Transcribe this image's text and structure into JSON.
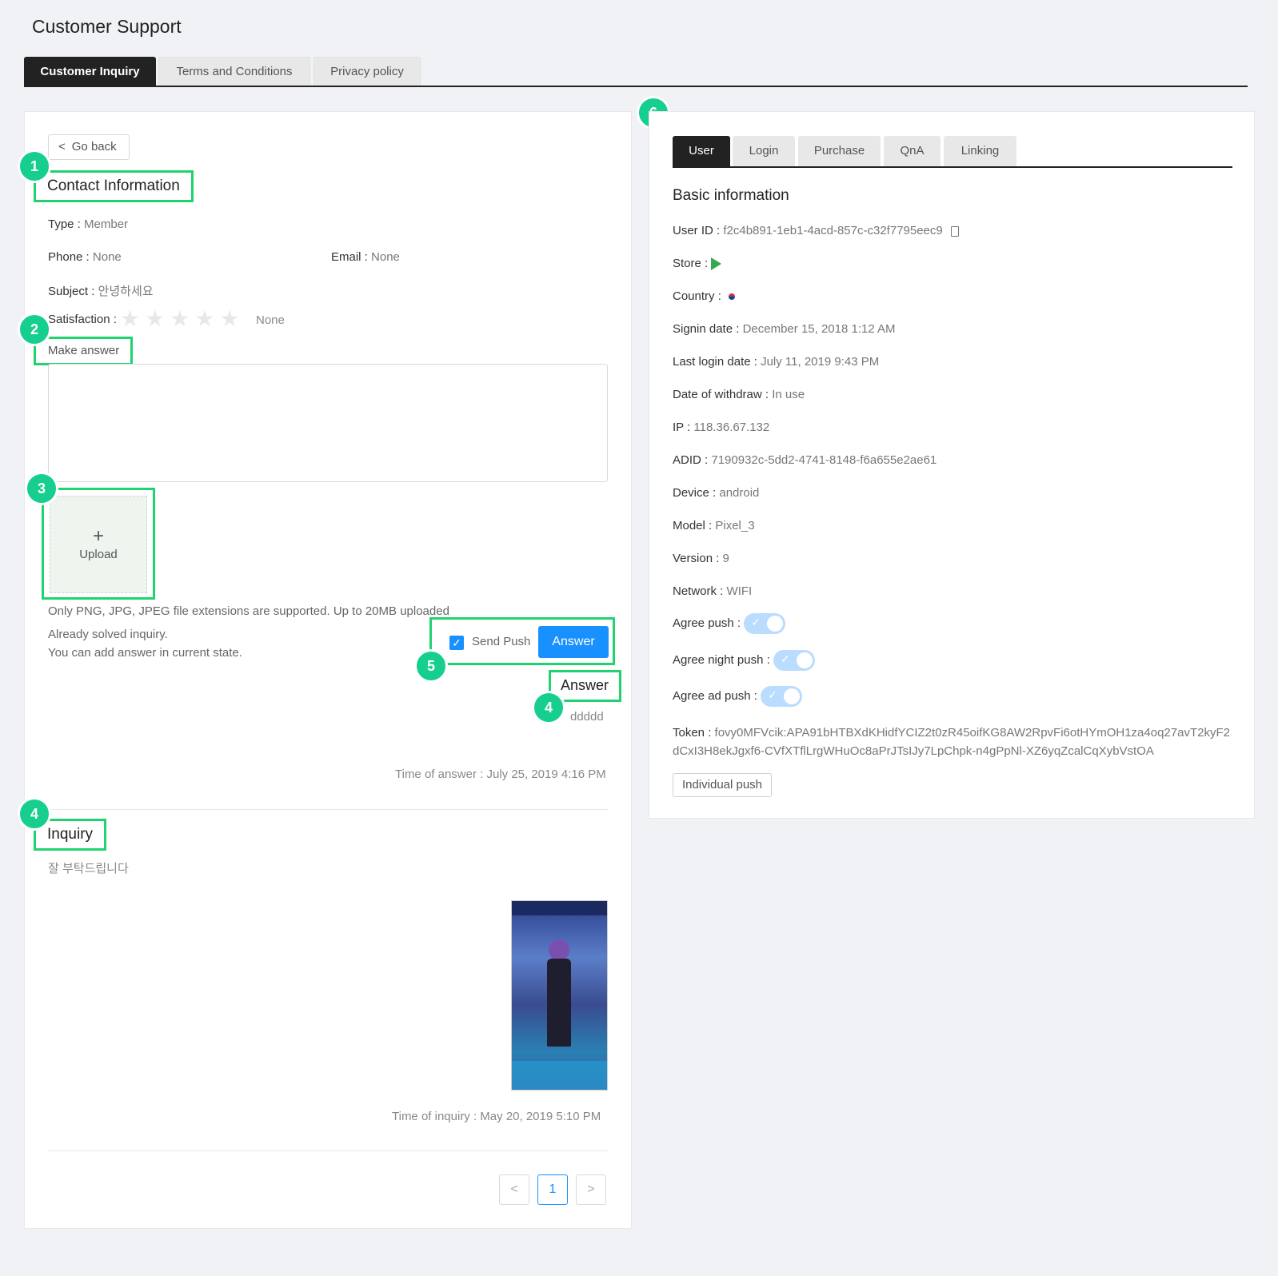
{
  "header": {
    "title": "Customer Support"
  },
  "main_tabs": [
    {
      "label": "Customer Inquiry"
    },
    {
      "label": "Terms and Conditions"
    },
    {
      "label": "Privacy policy"
    }
  ],
  "left": {
    "go_back": "Go back",
    "contact_title": "Contact Information",
    "type_label": "Type :",
    "type_value": "Member",
    "phone_label": "Phone :",
    "phone_value": "None",
    "email_label": "Email :",
    "email_value": "None",
    "subject_label": "Subject :",
    "subject_value": "안녕하세요",
    "satisfaction_label": "Satisfaction :",
    "satisfaction_value": "None",
    "satisfaction_stars": 0,
    "make_answer": "Make answer",
    "upload_label": "Upload",
    "upload_note": "Only PNG, JPG, JPEG file extensions are supported. Up to 20MB uploaded",
    "solved_line1": "Already solved inquiry.",
    "solved_line2": "You can add answer in current state.",
    "send_push_label": "Send Push",
    "send_push_checked": true,
    "answer_button": "Answer",
    "answer_title": "Answer",
    "answer_text": "ddddd",
    "answer_time": "Time of answer : July 25, 2019 4:16 PM",
    "inquiry_title": "Inquiry",
    "inquiry_text": "잘 부탁드립니다",
    "inquiry_time": "Time of inquiry : May 20, 2019 5:10 PM",
    "pagination": {
      "prev": "<",
      "current": "1",
      "next": ">"
    }
  },
  "badges": {
    "b1": "1",
    "b2": "2",
    "b3": "3",
    "b4a": "4",
    "b4b": "4",
    "b5": "5",
    "b6": "6"
  },
  "right": {
    "tabs": [
      {
        "label": "User"
      },
      {
        "label": "Login"
      },
      {
        "label": "Purchase"
      },
      {
        "label": "QnA"
      },
      {
        "label": "Linking"
      }
    ],
    "section_title": "Basic information",
    "user_id_label": "User ID :",
    "user_id_value": "f2c4b891-1eb1-4acd-857c-c32f7795eec9",
    "store_label": "Store :",
    "country_label": "Country :",
    "signin_label": "Signin date :",
    "signin_value": "December 15, 2018 1:12 AM",
    "lastlogin_label": "Last login date :",
    "lastlogin_value": "July 11, 2019 9:43 PM",
    "withdraw_label": "Date of withdraw :",
    "withdraw_value": "In use",
    "ip_label": "IP :",
    "ip_value": "118.36.67.132",
    "adid_label": "ADID :",
    "adid_value": "7190932c-5dd2-4741-8148-f6a655e2ae61",
    "device_label": "Device :",
    "device_value": "android",
    "model_label": "Model :",
    "model_value": "Pixel_3",
    "version_label": "Version :",
    "version_value": "9",
    "network_label": "Network :",
    "network_value": "WIFI",
    "agree_push_label": "Agree push :",
    "agree_night_label": "Agree night push :",
    "agree_ad_label": "Agree ad push :",
    "token_label": "Token :",
    "token_value_1": "fovy0MFVcik:APA91bHTBXdKHidfYCIZ2t0zR45oifKG8AW2RpvFi6otHYmOH1za4oq27avT2kyF2",
    "token_value_2": "dCxI3H8ekJgxf6-CVfXTflLrgWHuOc8aPrJTsIJy7LpChpk-n4gPpNl-XZ6yqZcalCqXybVstOA",
    "individual_push": "Individual push"
  },
  "colors": {
    "highlight": "#1fd36f",
    "badge": "#16cf8f",
    "primary": "#1890ff"
  }
}
